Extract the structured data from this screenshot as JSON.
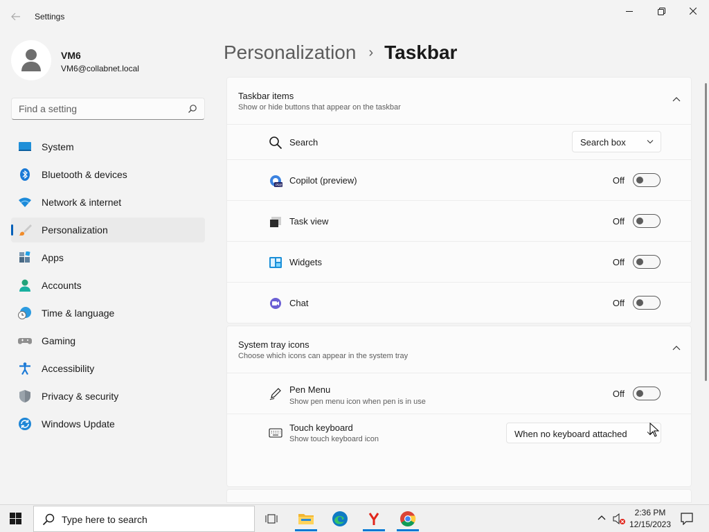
{
  "window": {
    "title": "Settings"
  },
  "profile": {
    "name": "VM6",
    "email": "VM6@collabnet.local"
  },
  "search": {
    "placeholder": "Find a setting"
  },
  "sidebar": {
    "items": [
      {
        "label": "System",
        "icon": "system-icon",
        "active": false
      },
      {
        "label": "Bluetooth & devices",
        "icon": "bluetooth-icon",
        "active": false
      },
      {
        "label": "Network & internet",
        "icon": "wifi-icon",
        "active": false
      },
      {
        "label": "Personalization",
        "icon": "paintbrush-icon",
        "active": true
      },
      {
        "label": "Apps",
        "icon": "apps-icon",
        "active": false
      },
      {
        "label": "Accounts",
        "icon": "accounts-icon",
        "active": false
      },
      {
        "label": "Time & language",
        "icon": "clock-globe-icon",
        "active": false
      },
      {
        "label": "Gaming",
        "icon": "gamepad-icon",
        "active": false
      },
      {
        "label": "Accessibility",
        "icon": "accessibility-icon",
        "active": false
      },
      {
        "label": "Privacy & security",
        "icon": "shield-icon",
        "active": false
      },
      {
        "label": "Windows Update",
        "icon": "update-icon",
        "active": false
      }
    ]
  },
  "breadcrumb": {
    "parent": "Personalization",
    "separator": "›",
    "current": "Taskbar"
  },
  "taskbar_items": {
    "title": "Taskbar items",
    "description": "Show or hide buttons that appear on the taskbar",
    "search": {
      "label": "Search",
      "value": "Search box"
    },
    "rows": [
      {
        "label": "Copilot (preview)",
        "state": "Off"
      },
      {
        "label": "Task view",
        "state": "Off"
      },
      {
        "label": "Widgets",
        "state": "Off"
      },
      {
        "label": "Chat",
        "state": "Off"
      }
    ]
  },
  "system_tray": {
    "title": "System tray icons",
    "description": "Choose which icons can appear in the system tray",
    "pen_menu": {
      "label": "Pen Menu",
      "sub": "Show pen menu icon when pen is in use",
      "state": "Off"
    },
    "touch_keyboard": {
      "label": "Touch keyboard",
      "sub": "Show touch keyboard icon",
      "value": "When no keyboard attached"
    }
  },
  "taskbar": {
    "search_text": "Type here to search",
    "time": "2:36 PM",
    "date": "12/15/2023"
  },
  "colors": {
    "accent": "#005fb8",
    "taskbar_indicator": "#0078d4"
  }
}
